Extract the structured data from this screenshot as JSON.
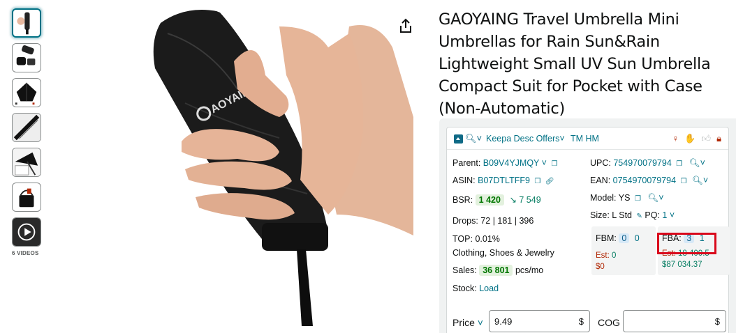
{
  "thumbnails": {
    "videos_label": "6 VIDEOS",
    "items": [
      "umbrella-closed",
      "umbrella-folded-case",
      "umbrella-open",
      "umbrella-detail",
      "umbrella-sun",
      "umbrella-bag",
      "video"
    ]
  },
  "main_image": {
    "brand_text": "AOYAING"
  },
  "product": {
    "title": "GAOYAING Travel Umbrella Mini Umbrellas for Rain Sun&Rain Lightweight Small UV Sun Umbrella Compact Suit for Pocket with Case (Non-Automatic)"
  },
  "keepa": {
    "toolbar": {
      "desc_offers": "Keepa Desc Offers",
      "tm": "TM HM"
    },
    "parent_label": "Parent:",
    "parent_value": "B09V4YJMQY",
    "asin_label": "ASIN:",
    "asin_value": "B07DTLTFF9",
    "bsr_label": "BSR:",
    "bsr_value": "1 420",
    "bsr_trend": "↘ 7 549",
    "drops_label": "Drops:",
    "drops_value": "72 | 181 | 396",
    "top_label": "TOP:",
    "top_value": "0.01%",
    "category": "Clothing, Shoes & Jewelry",
    "sales_label": "Sales:",
    "sales_value": "36 801",
    "sales_unit": "pcs/mo",
    "stock_label": "Stock:",
    "stock_value": "Load",
    "upc_label": "UPC:",
    "upc_value": "754970079794",
    "ean_label": "EAN:",
    "ean_value": "0754970079794",
    "model_label": "Model:",
    "model_value": "YS",
    "size_label": "Size:",
    "size_value": "L Std",
    "pq_label": "PQ:",
    "pq_value": "1",
    "fbm_label": "FBM:",
    "fbm_value_1": "0",
    "fbm_value_2": "0",
    "fbm_est_label": "Est:",
    "fbm_est_value": "0",
    "fbm_revenue": "$0",
    "fba_label": "FBA:",
    "fba_value_1": "3",
    "fba_value_2": "1",
    "fba_est_label": "Est:",
    "fba_est_value": "18 400.5",
    "fba_revenue": "$87 034.37",
    "price_label": "Price",
    "price_value": "9.49",
    "currency": "$",
    "cog_label": "COG",
    "cog_value": ""
  },
  "colors": {
    "link": "#007185",
    "highlight": "#d9091b",
    "green": "#067d62",
    "red": "#b12704"
  }
}
